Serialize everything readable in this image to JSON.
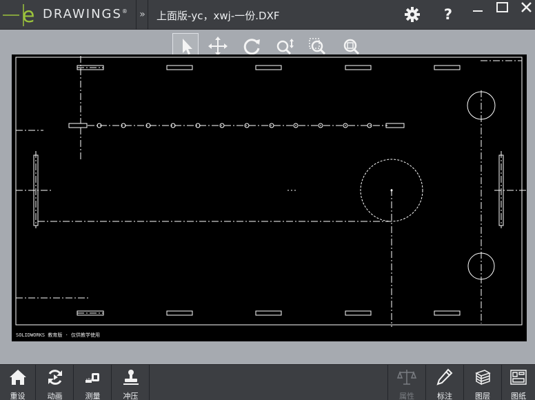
{
  "app": {
    "brand": "DRAWINGS",
    "brand_reg": "®",
    "document_title": "上面版-yc，xwj-一份.DXF"
  },
  "titlebar": {
    "help_label": "?"
  },
  "drawing": {
    "footer_text": "SOLIDWORKS 教育版 · 仅供教学使用"
  },
  "bottombar": {
    "left_items": [
      {
        "label": "重设",
        "icon": "home-icon"
      },
      {
        "label": "动画",
        "icon": "animate-icon"
      },
      {
        "label": "测量",
        "icon": "measure-icon"
      },
      {
        "label": "冲压",
        "icon": "stamp-icon"
      }
    ],
    "right_items": [
      {
        "label": "属性",
        "icon": "scale-icon",
        "enabled": false
      },
      {
        "label": "标注",
        "icon": "pencil-icon",
        "enabled": true
      },
      {
        "label": "图层",
        "icon": "layers-icon",
        "enabled": true
      },
      {
        "label": "图纸",
        "icon": "sheets-icon",
        "enabled": true
      }
    ]
  },
  "colors": {
    "titlebar_bg": "#3c3e42",
    "background": "#a6aab0",
    "canvas": "#000000",
    "drawing_line": "#ffffff"
  }
}
